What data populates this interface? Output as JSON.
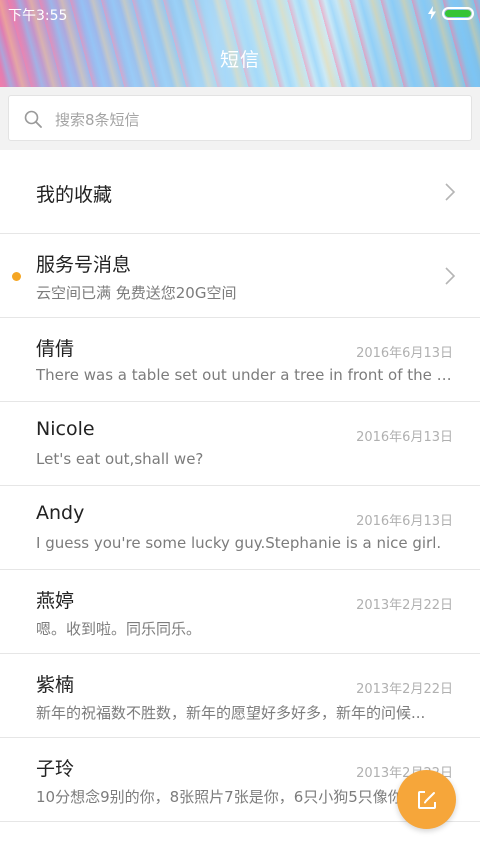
{
  "status_bar": {
    "time": "下午3:55",
    "battery_color": "#35c435"
  },
  "header": {
    "title": "短信"
  },
  "search": {
    "placeholder": "搜索8条短信"
  },
  "favorites": {
    "label": "我的收藏"
  },
  "service": {
    "title": "服务号消息",
    "subtitle": "云空间已满 免费送您20G空间",
    "unread_dot_color": "#f5a623"
  },
  "conversations": [
    {
      "name": "倩倩",
      "date": "2016年6月13日",
      "preview": "There was a table set out under a tree in front of the ho..."
    },
    {
      "name": "Nicole",
      "date": "2016年6月13日",
      "preview": "Let's eat out,shall we?"
    },
    {
      "name": "Andy",
      "date": "2016年6月13日",
      "preview": "I guess you're some lucky guy.Stephanie is a nice girl."
    },
    {
      "name": "燕婷",
      "date": "2013年2月22日",
      "preview": "嗯。收到啦。同乐同乐。"
    },
    {
      "name": "紫楠",
      "date": "2013年2月22日",
      "preview": "新年的祝福数不胜数，新年的愿望好多好多，新年的问候..."
    },
    {
      "name": "子玲",
      "date": "2013年2月22日",
      "preview": "10分想念9别的你，8张照片7张是你，6只小狗5只像你"
    }
  ],
  "compose": {
    "icon": "compose-icon",
    "color": "#f6a63a"
  }
}
